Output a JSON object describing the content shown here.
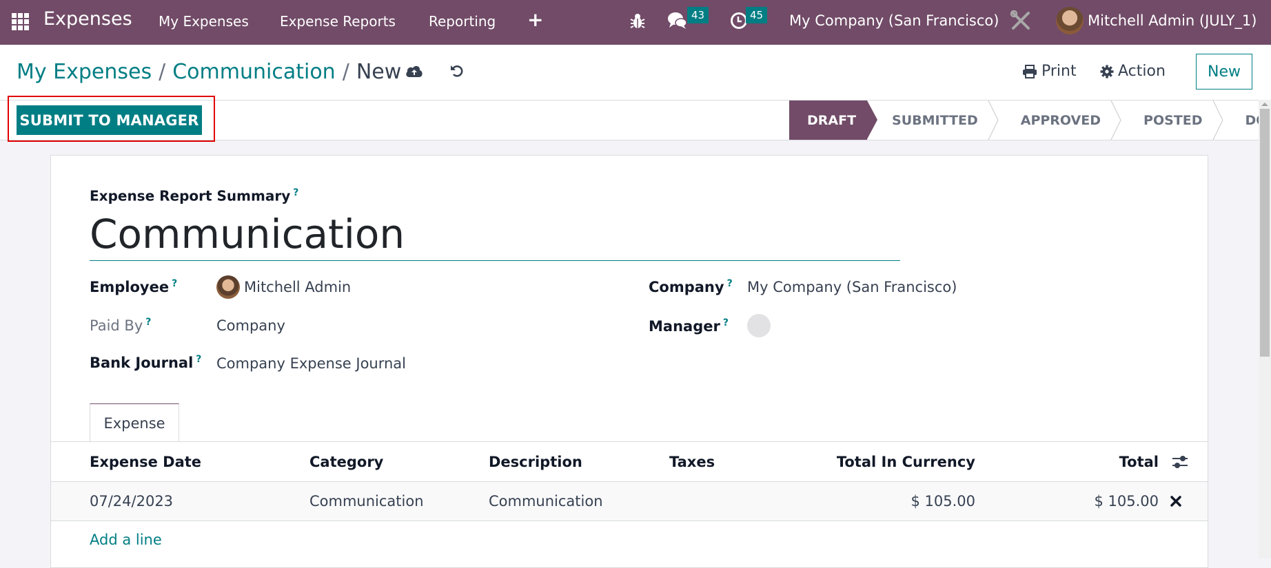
{
  "navbar": {
    "app_name": "Expenses",
    "menu": [
      "My Expenses",
      "Expense Reports",
      "Reporting"
    ],
    "messages_count": "43",
    "activities_count": "45",
    "company": "My Company (San Francisco)",
    "user": "Mitchell Admin (JULY_1)"
  },
  "breadcrumb": {
    "items": [
      "My Expenses",
      "Communication"
    ],
    "current": "New",
    "separator": "/"
  },
  "actions": {
    "print": "Print",
    "action": "Action",
    "new": "New"
  },
  "statusbar": {
    "submit_label": "SUBMIT TO MANAGER",
    "stages": [
      "DRAFT",
      "SUBMITTED",
      "APPROVED",
      "POSTED",
      "DONE"
    ],
    "active_stage": "DRAFT"
  },
  "form": {
    "summary_label": "Expense Report Summary",
    "title": "Communication",
    "help_mark": "?",
    "fields": {
      "employee": {
        "label": "Employee",
        "value": "Mitchell Admin"
      },
      "paid_by": {
        "label": "Paid By",
        "value": "Company"
      },
      "bank_journal": {
        "label": "Bank Journal",
        "value": "Company Expense Journal"
      },
      "company": {
        "label": "Company",
        "value": "My Company (San Francisco)"
      },
      "manager": {
        "label": "Manager",
        "value": ""
      }
    },
    "tabs": [
      "Expense"
    ],
    "table": {
      "columns": [
        "Expense Date",
        "Category",
        "Description",
        "Taxes",
        "Total In Currency",
        "Total"
      ],
      "rows": [
        {
          "date": "07/24/2023",
          "category": "Communication",
          "description": "Communication",
          "taxes": "",
          "total_currency": "$ 105.00",
          "total": "$ 105.00"
        }
      ],
      "add_line": "Add a line"
    }
  },
  "colors": {
    "brand": "#714b67",
    "accent": "#017e84",
    "highlight": "#e00000"
  }
}
